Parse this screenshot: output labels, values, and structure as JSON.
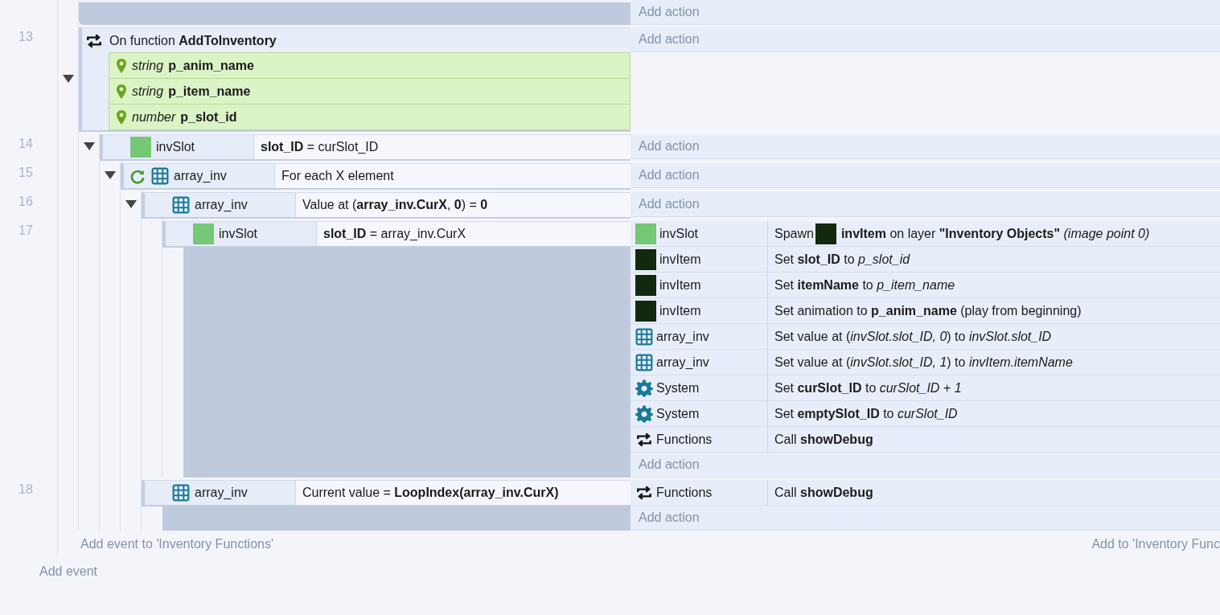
{
  "previous_event": {
    "add_action": "Add action"
  },
  "events": [
    {
      "number": "13",
      "expanded": true,
      "add_action": "Add action",
      "conditions": [
        {
          "kind": "function",
          "text": "On function **AddToInventory**",
          "params": [
            {
              "type": "string",
              "name": "p_anim_name"
            },
            {
              "type": "string",
              "name": "p_item_name"
            },
            {
              "type": "number",
              "name": "p_slot_id"
            }
          ]
        }
      ],
      "children": [
        {
          "number": "14",
          "expanded": true,
          "add_action": "Add action",
          "conditions": [
            {
              "kind": "object",
              "object": {
                "name": "invSlot",
                "kind": "sprite",
                "color": "#76c776"
              },
              "text": "**slot_ID** = curSlot_ID"
            }
          ],
          "children": [
            {
              "number": "15",
              "expanded": true,
              "add_action": "Add action",
              "conditions": [
                {
                  "kind": "loop",
                  "object": {
                    "name": "array_inv",
                    "kind": "array"
                  },
                  "text": "For each X element"
                }
              ],
              "children": [
                {
                  "number": "16",
                  "expanded": true,
                  "add_action": "Add action",
                  "conditions": [
                    {
                      "kind": "object",
                      "object": {
                        "name": "array_inv",
                        "kind": "array"
                      },
                      "text": "Value at (**array_inv.CurX**, **0**) = **0**"
                    }
                  ],
                  "children": [
                    {
                      "number": "17",
                      "add_action": "Add action",
                      "conditions": [
                        {
                          "kind": "object",
                          "object": {
                            "name": "invSlot",
                            "kind": "sprite",
                            "color": "#76c776"
                          },
                          "text": "**slot_ID** = array_inv.CurX"
                        }
                      ],
                      "actions": [
                        {
                          "object": {
                            "name": "invSlot",
                            "kind": "sprite",
                            "color": "#76c776"
                          },
                          "text": "Spawn",
                          "inline_object": {
                            "kind": "sprite",
                            "color": "#12290f"
                          },
                          "text_after": "**invItem** on layer **\"Inventory Objects\"** *(image point 0)*"
                        },
                        {
                          "object": {
                            "name": "invItem",
                            "kind": "sprite",
                            "color": "#12290f"
                          },
                          "text": "Set **slot_ID** to *p_slot_id*"
                        },
                        {
                          "object": {
                            "name": "invItem",
                            "kind": "sprite",
                            "color": "#12290f"
                          },
                          "text": "Set **itemName** to *p_item_name*"
                        },
                        {
                          "object": {
                            "name": "invItem",
                            "kind": "sprite",
                            "color": "#12290f"
                          },
                          "text": "Set animation to **p_anim_name** (play from beginning)"
                        },
                        {
                          "object": {
                            "name": "array_inv",
                            "kind": "array"
                          },
                          "text": "Set value at (*invSlot.slot_ID, 0*) to *invSlot.slot_ID*"
                        },
                        {
                          "object": {
                            "name": "array_inv",
                            "kind": "array"
                          },
                          "text": "Set value at (*invSlot.slot_ID, 1*) to *invItem.itemName*"
                        },
                        {
                          "object": {
                            "name": "System",
                            "kind": "system"
                          },
                          "text": "Set **curSlot_ID** to *curSlot_ID + 1*"
                        },
                        {
                          "object": {
                            "name": "System",
                            "kind": "system"
                          },
                          "text": "Set **emptySlot_ID** to *curSlot_ID*"
                        },
                        {
                          "object": {
                            "name": "Functions",
                            "kind": "functions"
                          },
                          "text": "Call **showDebug**"
                        }
                      ]
                    }
                  ]
                },
                {
                  "number": "18",
                  "add_action": "Add action",
                  "conditions": [
                    {
                      "kind": "object",
                      "object": {
                        "name": "array_inv",
                        "kind": "array"
                      },
                      "text": "Current value = **LoopIndex(array_inv.CurX)**"
                    }
                  ],
                  "actions": [
                    {
                      "object": {
                        "name": "Functions",
                        "kind": "functions"
                      },
                      "text": "Call **showDebug**"
                    }
                  ]
                }
              ]
            }
          ]
        }
      ]
    }
  ],
  "add_event_to_group": "Add event to 'Inventory Functions'",
  "add_to_group": "Add to 'Inventory Func",
  "add_event": "Add event"
}
